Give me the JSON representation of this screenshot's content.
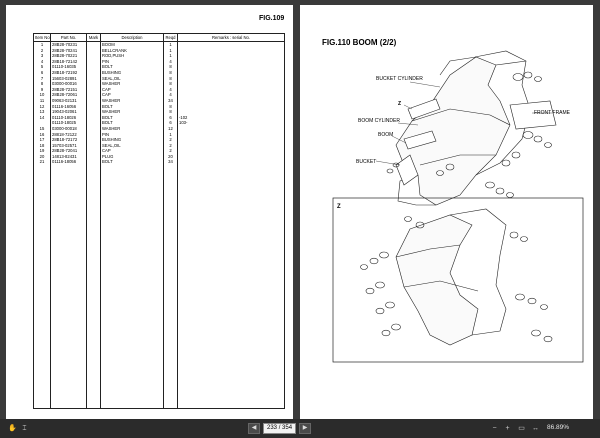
{
  "left_page": {
    "fig_label": "FIG.109",
    "headers": {
      "item_no": "Item No.",
      "part_no": "Part No.",
      "mark": "Mark",
      "description": "Description",
      "reqd": "Reqd",
      "remarks": "Remarks : serial No."
    },
    "rows": [
      {
        "no": "1",
        "part": "28B28-70231",
        "desc": "BOOM",
        "qty": "1",
        "rem": ""
      },
      {
        "no": "2",
        "part": "28B28-70241",
        "desc": "BELLCRANK",
        "qty": "1",
        "rem": ""
      },
      {
        "no": "3",
        "part": "28B28-70221",
        "desc": "ROD,PUSH",
        "qty": "1",
        "rem": ""
      },
      {
        "no": "4",
        "part": "28B18-72142",
        "desc": "PIN",
        "qty": "4",
        "rem": ""
      },
      {
        "no": "5",
        "part": "01110-16035",
        "desc": "BOLT",
        "qty": "8",
        "rem": ""
      },
      {
        "no": "6",
        "part": "28B18-72192",
        "desc": "BUSHING",
        "qty": "8",
        "rem": ""
      },
      {
        "no": "7",
        "part": "15603-02891",
        "desc": "SEAL,OIL",
        "qty": "8",
        "rem": ""
      },
      {
        "no": "8",
        "part": "03000-00016",
        "desc": "WASHER",
        "qty": "8",
        "rem": ""
      },
      {
        "no": "9",
        "part": "28B28-72151",
        "desc": "CAP",
        "qty": "4",
        "rem": ""
      },
      {
        "no": "10",
        "part": "28B28-72061",
        "desc": "CAP",
        "qty": "4",
        "rem": ""
      },
      {
        "no": "11",
        "part": "09063-02131",
        "desc": "WASHER",
        "qty": "34",
        "rem": ""
      },
      {
        "no": "12",
        "part": "01116-16056",
        "desc": "BOLT",
        "qty": "8",
        "rem": ""
      },
      {
        "no": "13",
        "part": "19043-02061",
        "desc": "WASHER",
        "qty": "8",
        "rem": ""
      },
      {
        "no": "14",
        "part": "01110-18026",
        "desc": "BOLT",
        "qty": "6",
        "rem": "-102"
      },
      {
        "no": "",
        "part": "01110-18025",
        "desc": "BOLT",
        "qty": "6",
        "rem": "103-"
      },
      {
        "no": "15",
        "part": "03000-00018",
        "desc": "WASHER",
        "qty": "12",
        "rem": ""
      },
      {
        "no": "16",
        "part": "28818-72122",
        "desc": "PIN",
        "qty": "1",
        "rem": ""
      },
      {
        "no": "17",
        "part": "28B18-72172",
        "desc": "BUSHING",
        "qty": "2",
        "rem": ""
      },
      {
        "no": "18",
        "part": "15703-02571",
        "desc": "SEAL,OIL",
        "qty": "2",
        "rem": ""
      },
      {
        "no": "19",
        "part": "28B28-72041",
        "desc": "CAP",
        "qty": "2",
        "rem": ""
      },
      {
        "no": "20",
        "part": "14813-82431",
        "desc": "PLUG",
        "qty": "20",
        "rem": ""
      },
      {
        "no": "21",
        "part": "01116-18056",
        "desc": "BOLT",
        "qty": "34",
        "rem": ""
      }
    ]
  },
  "right_page": {
    "fig_label": "FIG.110",
    "title": "FIG.110   BOOM (2/2)",
    "callouts": {
      "bucket_cylinder": "BUCKET CYLINDER",
      "front_frame": "FRONT FRAME",
      "boom_cylinder": "BOOM CYLINDER",
      "boom": "BOOM",
      "bucket": "BUCKET",
      "z": "Z",
      "z_detail": "Z"
    }
  },
  "viewer": {
    "page_current": "233",
    "page_total": "/ 354",
    "zoom": "86.89%",
    "tool_icons": [
      "hand-icon",
      "select-icon",
      "zoom-in-icon",
      "fit-page-icon",
      "fit-width-icon",
      "rotate-icon"
    ]
  }
}
